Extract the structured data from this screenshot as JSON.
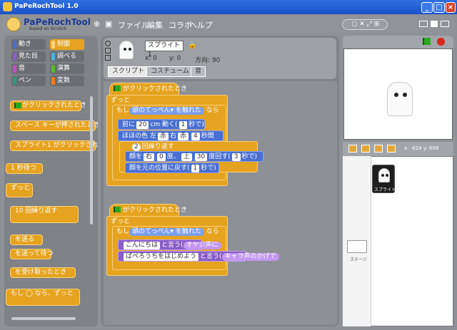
{
  "window": {
    "title": "PaPeRochTool 1.0"
  },
  "toolbar": {
    "logo": "PaPeRochTool",
    "logo_sub": "Based on Scratch",
    "menus": [
      "ファイル",
      "編集",
      "コラボ",
      "ヘルプ"
    ],
    "zoom_pill": " ○ ✕ ⤢ ⊞"
  },
  "categories": [
    {
      "label": "動き",
      "color": "#4a6fd1"
    },
    {
      "label": "制御",
      "color": "#e6a31f"
    },
    {
      "label": "見た目",
      "color": "#8a5dc8"
    },
    {
      "label": "調べる",
      "color": "#4fb3d9"
    },
    {
      "label": "音",
      "color": "#c250c2"
    },
    {
      "label": "演算",
      "color": "#5cb82e"
    },
    {
      "label": "ペン",
      "color": "#2c9a7a"
    },
    {
      "label": "変数",
      "color": "#f07d1f"
    }
  ],
  "palette": [
    "がクリックされたとき",
    "スペース キーが押されたとき",
    "スプライト1 がクリックされたとき",
    "1 秒待つ",
    "ずっと",
    "10 回繰り返す",
    "を送る",
    "を送って待つ",
    "を受け取ったとき",
    "もし ◯ なら、ずっと"
  ],
  "sprite": {
    "name": "スプライト1",
    "x_label": "x: 0",
    "y_label": "y: 0",
    "dir_label": "方向: 90"
  },
  "tabs": [
    "スクリプト",
    "コスチューム",
    "音"
  ],
  "script1": {
    "hat": "がクリックされたとき",
    "forever": "ずっと",
    "if_prefix": "もし",
    "touching": "触れた",
    "touch_target": "頭のてっぺん",
    "if_suffix": "なら",
    "move_a": "前に",
    "move_v1": "20",
    "move_b": "cm 動く(",
    "move_v2": "1",
    "move_c": "秒で)",
    "color_a": "ほほの色",
    "color_v1": "左",
    "color_v2": "赤",
    "color_v3": "右",
    "color_v4": "赤",
    "color_v5": "4",
    "color_b": "秒間",
    "repeat_v": "2",
    "repeat_label": "回繰り返す",
    "neck_a": "顔を",
    "neck_v1": "右",
    "neck_v2": "0",
    "neck_b": "度、",
    "neck_v3": "上",
    "neck_v4": "30",
    "neck_c": "度回す(",
    "neck_v5": "3",
    "neck_d": "秒で)",
    "reset_a": "顔を元の位置に戻す(",
    "reset_v": "1",
    "reset_b": "秒で)"
  },
  "script2": {
    "hat": "がクリックされたとき",
    "forever": "ずっと",
    "if_prefix": "もし",
    "touch_target": "頭のてっぺん",
    "touching": "触れた",
    "if_suffix": "なら",
    "say1_text": "こんにちは",
    "say1_mid": "と言う(",
    "say1_voice": "オヤジ声に",
    "say2_text": "ぱぺろうちをはじめよう",
    "say2_mid": "と言う(",
    "say2_voice": "キャラ声のかげで"
  },
  "stage": {
    "coords": "x: -624  y: 608"
  },
  "sprites_panel": {
    "sprite_label": "スプライト...",
    "stage_label": "ステージ"
  }
}
